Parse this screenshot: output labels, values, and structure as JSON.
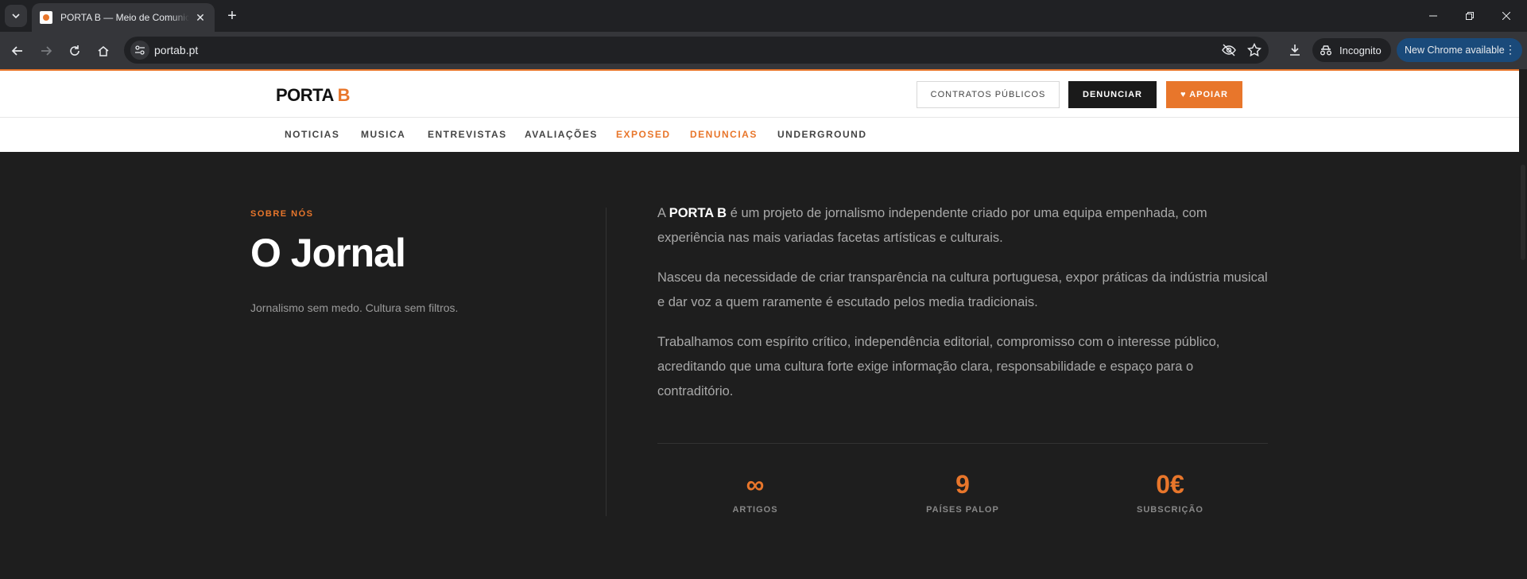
{
  "browser": {
    "tab_title": "PORTA B — Meio de Comunicação",
    "url": "portab.pt",
    "incognito_label": "Incognito",
    "update_label": "New Chrome available"
  },
  "site": {
    "logo_main": "PORTA ",
    "logo_accent": "B",
    "buttons": {
      "contracts": "CONTRATOS PÚBLICOS",
      "report": "DENUNCIAR",
      "support": "♥ APOIAR"
    },
    "nav": [
      {
        "label": "NOTICIAS",
        "highlight": false
      },
      {
        "label": "MUSICA",
        "highlight": false
      },
      {
        "label": "ENTREVISTAS",
        "highlight": false
      },
      {
        "label": "AVALIAÇÕES",
        "highlight": false
      },
      {
        "label": "EXPOSED",
        "highlight": true
      },
      {
        "label": "DENUNCIAS",
        "highlight": true
      },
      {
        "label": "UNDERGROUND",
        "highlight": false
      }
    ],
    "accent_color": "#e8762b"
  },
  "about": {
    "kicker": "SOBRE NÓS",
    "title": "O Jornal",
    "tagline": "Jornalismo sem medo. Cultura sem filtros.",
    "p1_prefix": "A ",
    "p1_brand": "PORTA B",
    "p1_rest": " é um projeto de jornalismo independente criado por uma equipa empenhada, com experiência nas mais variadas facetas artísticas e culturais.",
    "p2": "Nasceu da necessidade de criar transparência na cultura portuguesa, expor práticas da indústria musical e dar voz a quem raramente é escutado pelos media tradicionais.",
    "p3": "Trabalhamos com espírito crítico, independência editorial, compromisso com o interesse público, acreditando que uma cultura forte exige informação clara, responsabilidade e espaço para o contraditório.",
    "stats": [
      {
        "value": "∞",
        "label": "ARTIGOS"
      },
      {
        "value": "9",
        "label": "PAÍSES PALOP"
      },
      {
        "value": "0€",
        "label": "SUBSCRIÇÃO"
      }
    ]
  }
}
